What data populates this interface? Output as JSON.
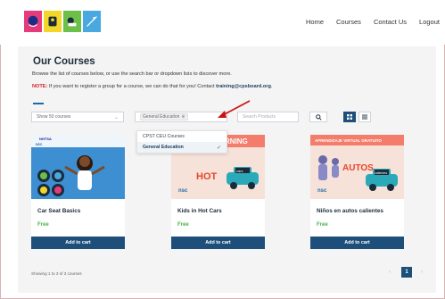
{
  "nav": {
    "items": [
      "Home",
      "Courses",
      "Contact Us",
      "Logout"
    ]
  },
  "logos": [
    "stop-sign-logo",
    "car-seat-logo",
    "hot-car-logo",
    "pedestrian-logo"
  ],
  "main": {
    "title": "Our Courses",
    "subtitle": "Browse the list of courses below, or use the search bar or dropdown lists to discover more.",
    "note_label": "NOTE:",
    "note_text": " If you want to register a group for a course, we can do that for you! Contact ",
    "note_email": "training@cpsboard.org",
    "note_end": "."
  },
  "toolbar": {
    "show_value": "Show 50 courses",
    "category_chip": "General Education",
    "search_placeholder": "Search Products"
  },
  "dropdown": {
    "options": [
      "CPST CEU Courses",
      "General Education"
    ],
    "selected_index": 1
  },
  "courses": [
    {
      "title": "Car Seat Basics",
      "price": "Free",
      "button": "Add to cart",
      "image_text": {
        "brand1": "NHTSA",
        "brand2": "NSC"
      }
    },
    {
      "title": "Kids in Hot Cars",
      "price": "Free",
      "button": "Add to cart",
      "image_text": {
        "banner": "LEARNING",
        "hot": "HOT",
        "cars": "cars",
        "brand": "nsc"
      }
    },
    {
      "title": "Niños en autos calientes",
      "price": "Free",
      "button": "Add to cart",
      "image_text": {
        "banner": "APRENDIZAJE VIRTUAL GRATUITO",
        "autos": "AUTOS",
        "calientes": "calientes",
        "brand": "nsc"
      }
    }
  ],
  "pagination": {
    "summary": "Showing 1 to 3 of 3 courses",
    "current_page": "1",
    "prev": "‹",
    "next": "›"
  },
  "colors": {
    "accent": "#1d4f7a",
    "price": "#47b548",
    "note": "#d0202a",
    "arrow": "#cc1111"
  }
}
